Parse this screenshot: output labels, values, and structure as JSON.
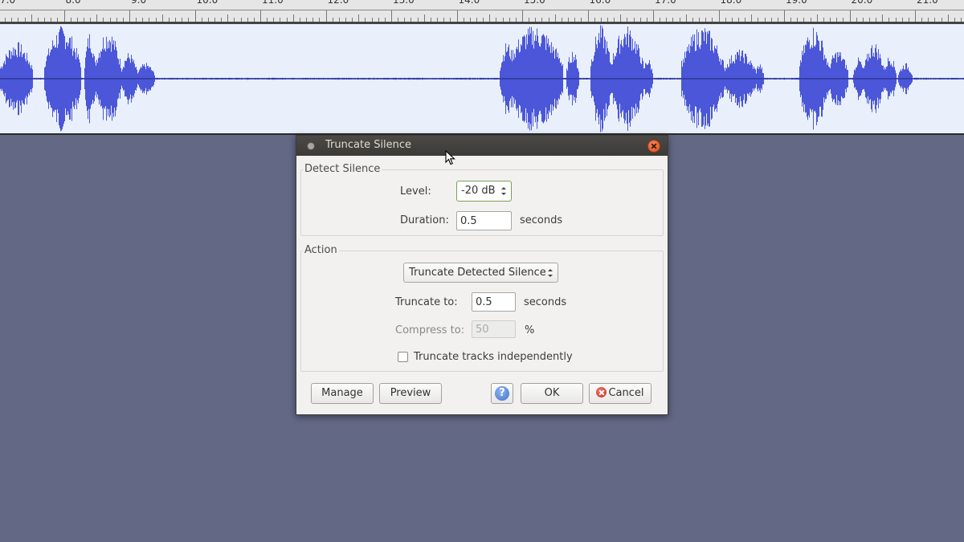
{
  "ruler": {
    "ticks": [
      "7.0",
      "8.0",
      "9.0",
      "10.0",
      "11.0",
      "12.0",
      "13.0",
      "14.0",
      "15.0",
      "16.0",
      "17.0",
      "18.0",
      "19.0",
      "20.0",
      "21.0"
    ]
  },
  "dialog": {
    "title": "Truncate Silence",
    "detect_silence": {
      "group_label": "Detect Silence",
      "level_label": "Level:",
      "level_value": "-20 dB",
      "duration_label": "Duration:",
      "duration_value": "0.5",
      "duration_unit": "seconds"
    },
    "action": {
      "group_label": "Action",
      "mode_value": "Truncate Detected Silence",
      "truncate_label": "Truncate to:",
      "truncate_value": "0.5",
      "truncate_unit": "seconds",
      "compress_label": "Compress to:",
      "compress_value": "50",
      "compress_unit": "%",
      "independent_label": "Truncate tracks independently",
      "independent_checked": false
    },
    "buttons": {
      "manage": "Manage",
      "preview": "Preview",
      "help": "?",
      "ok": "OK",
      "cancel": "Cancel"
    }
  },
  "colors": {
    "background": "#636885",
    "waveform": "#4b57d8",
    "waveform_bg": "#e9f0fb",
    "titlebar": "#3f3e3b",
    "close_button": "#df4b16"
  }
}
